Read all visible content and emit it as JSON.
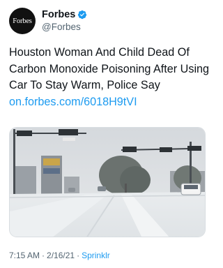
{
  "account": {
    "avatar_text": "Forbes",
    "display_name": "Forbes",
    "handle": "@Forbes",
    "verified_icon": "verified-badge-icon",
    "verified_color": "#1d9bf0"
  },
  "tweet": {
    "text": "Houston Woman And Child Dead Of Carbon Monoxide Poisoning After Using Car To Stay Warm, Police Say",
    "link": "on.forbes.com/6018H9tVI"
  },
  "media": {
    "description_icon": "snowy-street-photo"
  },
  "meta": {
    "time": "7:15 AM",
    "separator": "·",
    "date": "2/16/21",
    "separator2": "·",
    "source": "Sprinklr"
  },
  "colors": {
    "link": "#1d9bf0",
    "secondary_text": "#536471"
  }
}
